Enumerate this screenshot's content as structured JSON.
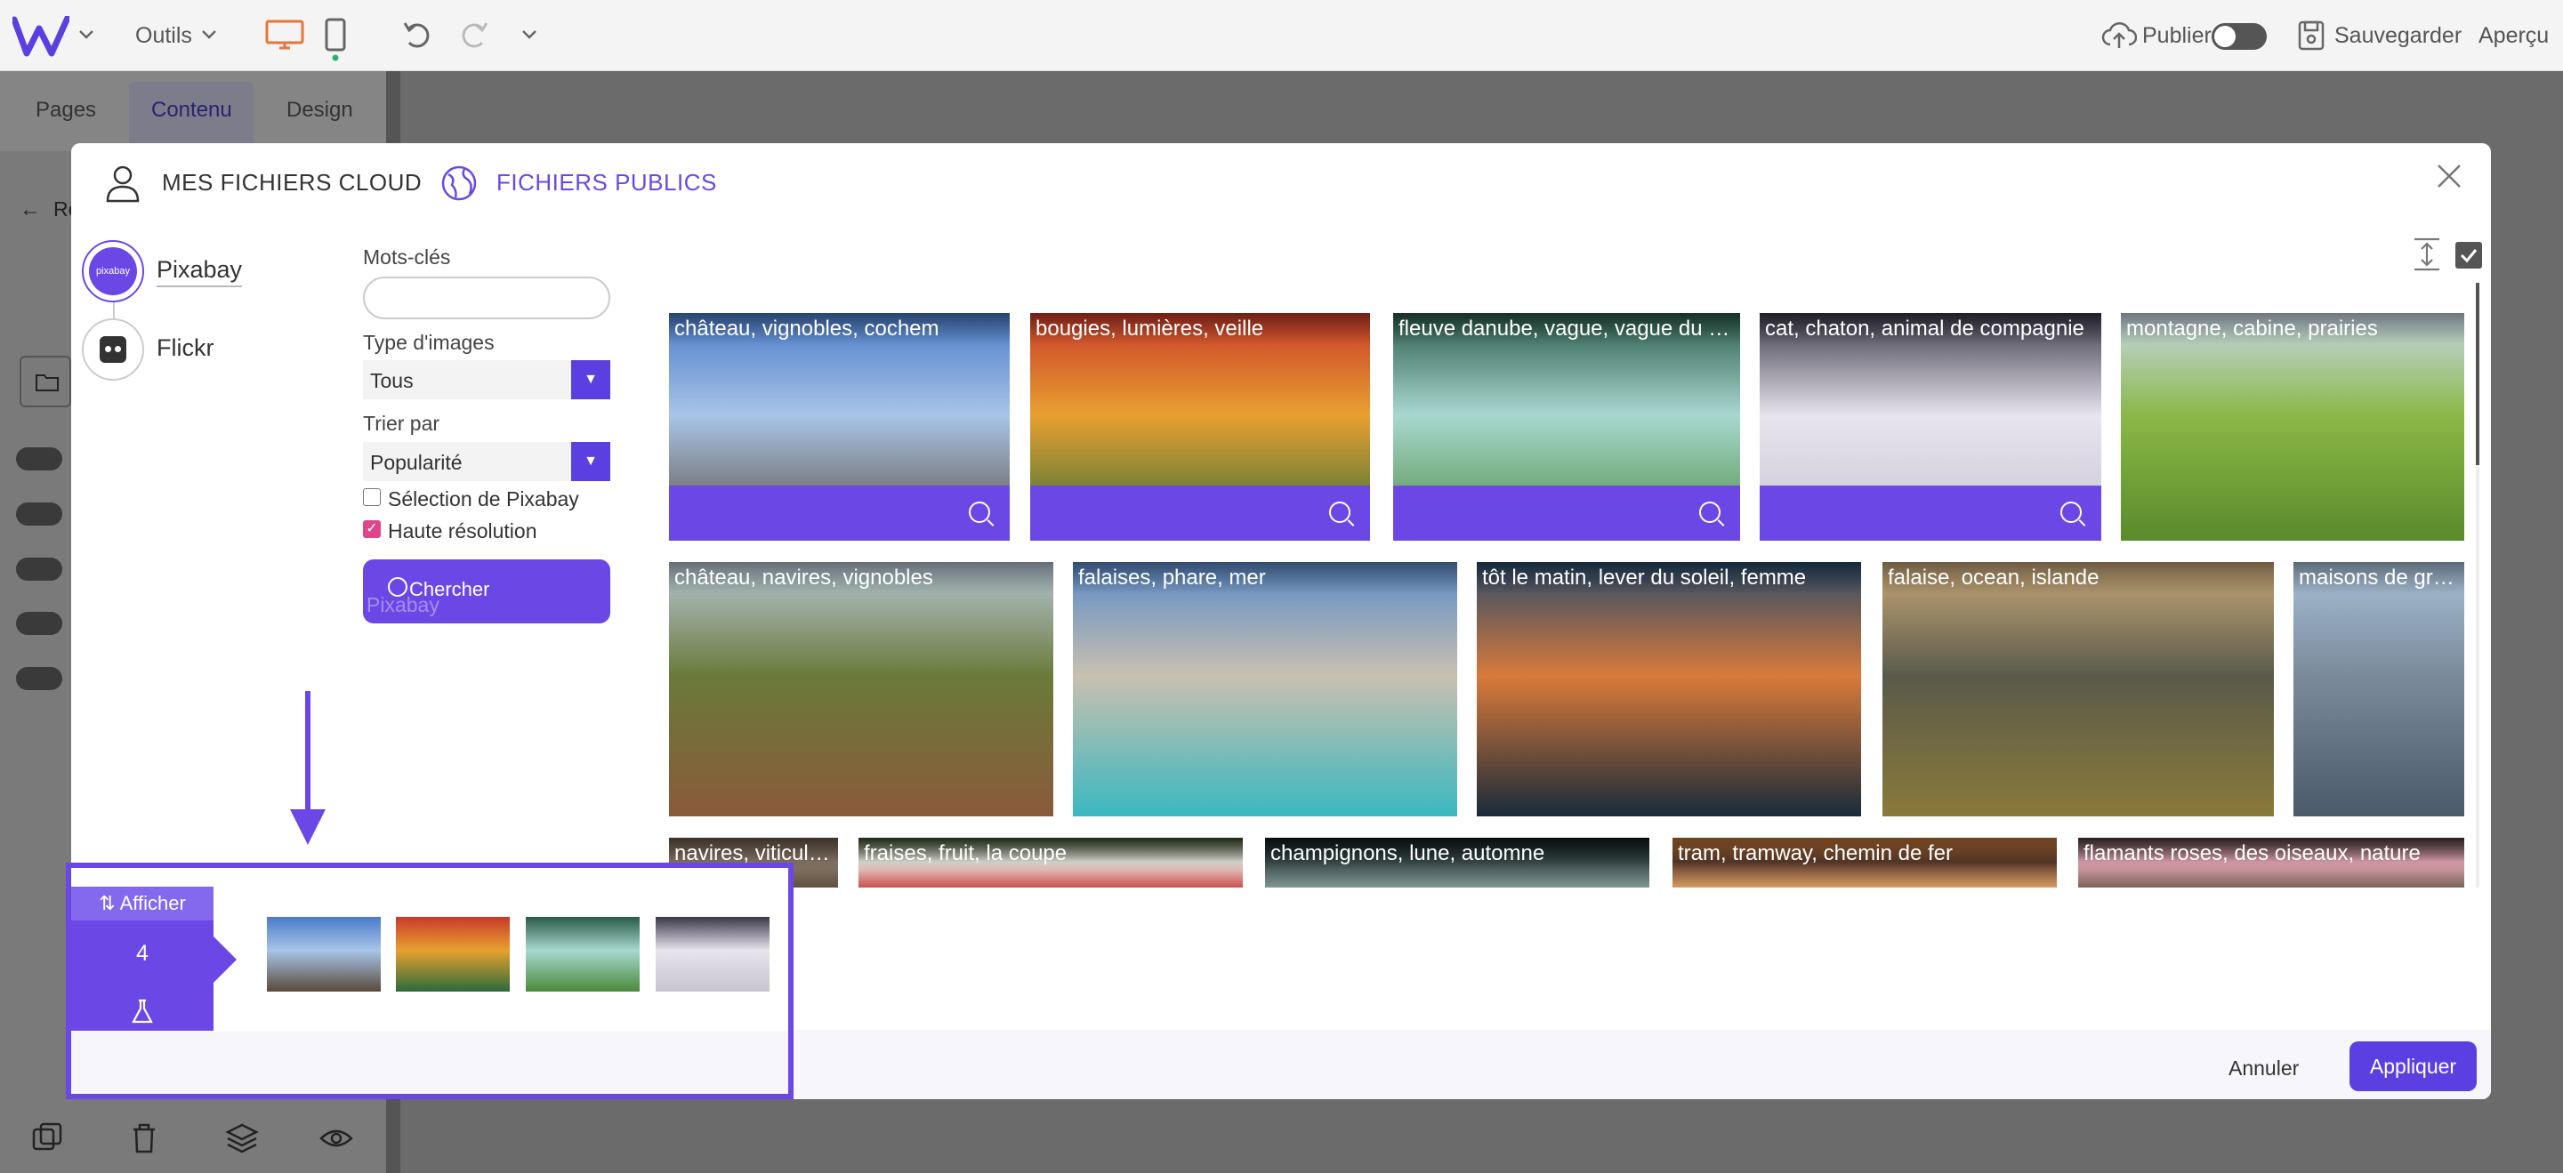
{
  "topbar": {
    "tools_label": "Outils",
    "publish_label": "Publier",
    "save_label": "Sauvegarder",
    "preview_label": "Aperçu"
  },
  "editor": {
    "tabs": [
      "Pages",
      "Contenu",
      "Design"
    ],
    "back_label": "Re"
  },
  "modal": {
    "tab_cloud": "MES FICHIERS CLOUD",
    "tab_public": "FICHIERS PUBLICS",
    "sources": [
      {
        "label": "Pixabay",
        "badge": "pixabay"
      },
      {
        "label": "Flickr"
      }
    ],
    "form": {
      "keywords_label": "Mots-clés",
      "keywords_value": "",
      "image_type_label": "Type d'images",
      "image_type_value": "Tous",
      "sort_label": "Trier par",
      "sort_value": "Popularité",
      "pixabay_selection_label": "Sélection de Pixabay",
      "pixabay_selection_checked": false,
      "high_res_label": "Haute résolution",
      "high_res_checked": true,
      "search_label": "Chercher",
      "search_ghost": "Pixabay"
    },
    "results": [
      {
        "caption": "château, vignobles, cochem",
        "selected": true,
        "colors": [
          "#4a7bc8",
          "#a8c4e8",
          "#5a4a3a"
        ]
      },
      {
        "caption": "bougies, lumières, veille",
        "selected": true,
        "colors": [
          "#c83a2a",
          "#e8a030",
          "#2a6a3a"
        ]
      },
      {
        "caption": "fleuve danube, vague, vague du danube",
        "selected": true,
        "colors": [
          "#2a5a4a",
          "#a8d8d0",
          "#4a8a3a"
        ]
      },
      {
        "caption": "cat, chaton, animal de compagnie",
        "selected": true,
        "colors": [
          "#3a3848",
          "#e8e4ee",
          "#c8c4d0"
        ]
      },
      {
        "caption": "montagne, cabine, prairies",
        "selected": false,
        "colors": [
          "#c8d8e8",
          "#8ab848",
          "#5a8a2a"
        ]
      },
      {
        "caption": "château, navires, vignobles",
        "selected": false,
        "colors": [
          "#b8c8d8",
          "#6a7a3a",
          "#8a5a3a"
        ]
      },
      {
        "caption": "falaises, phare, mer",
        "selected": false,
        "colors": [
          "#5a8ac8",
          "#c8c0b0",
          "#3ab8c0"
        ]
      },
      {
        "caption": "tôt le matin, lever du soleil, femme",
        "selected": false,
        "colors": [
          "#2a4a6a",
          "#d87a3a",
          "#1a2a3a"
        ]
      },
      {
        "caption": "falaise, ocean, islande",
        "selected": false,
        "colors": [
          "#c8a878",
          "#5a5a4a",
          "#8a7a3a"
        ]
      },
      {
        "caption": "maisons de grue, port",
        "selected": false,
        "colors": [
          "#a8c0d8",
          "#7a8a9a",
          "#4a5a6a"
        ]
      },
      {
        "caption": "navires, viticulture",
        "selected": false,
        "colors": [
          "#6a5a4a",
          "#8a7a6a",
          "#5a4a3a"
        ]
      },
      {
        "caption": "fraises, fruit, la coupe",
        "selected": false,
        "colors": [
          "#3a4a2a",
          "#e8e8e0",
          "#c83a3a"
        ]
      },
      {
        "caption": "champignons, lune, automne",
        "selected": false,
        "colors": [
          "#0a1a1a",
          "#3a4a4a",
          "#8aa0a0"
        ]
      },
      {
        "caption": "tram, tramway, chemin de fer",
        "selected": false,
        "colors": [
          "#c87a3a",
          "#5a3a2a",
          "#e8a868"
        ]
      },
      {
        "caption": "flamants roses, des oiseaux, nature",
        "selected": false,
        "colors": [
          "#4a3a3a",
          "#e8a8b8",
          "#6a5a4a"
        ]
      }
    ],
    "footer": {
      "cancel_label": "Annuler",
      "apply_label": "Appliquer"
    }
  },
  "tray": {
    "toggle_label": "Afficher",
    "count": "4"
  },
  "colors": {
    "accent": "#5b3fe0",
    "checkbox_checked": "#e0458c",
    "desktop_icon": "#e8743a"
  }
}
